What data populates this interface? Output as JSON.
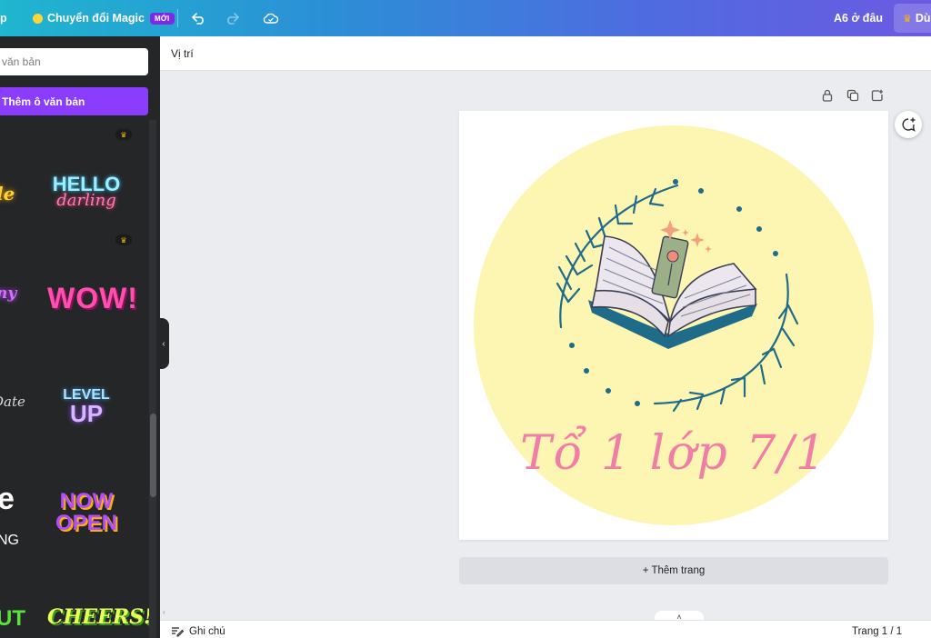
{
  "topbar": {
    "left_partial": "p",
    "magic_label": "Chuyển đổi Magic",
    "new_badge": "MỚI",
    "location_label": "A6 ở đâu",
    "try_label": "Dù"
  },
  "sidebar": {
    "search_placeholder": "văn bản",
    "add_text_button": "Thêm ô văn bản",
    "stickers": [
      {
        "top": "HELLO",
        "bottom": "darling"
      },
      {
        "text": "WOW!"
      },
      {
        "top": "LEVEL",
        "bottom": "UP"
      },
      {
        "top": "NOW",
        "bottom": "OPEN"
      },
      {
        "text": "CHEERS!"
      }
    ],
    "left_partials": [
      "le",
      "ny",
      "Date",
      "e",
      "NG",
      "UT"
    ]
  },
  "position_bar": {
    "label": "Vị trí"
  },
  "canvas": {
    "design_text": "Tổ 1 lớp 7/1",
    "add_page_button": "+ Thêm trang",
    "colors": {
      "circle": "#fdf6b2",
      "title": "#f07ea6",
      "leaves": "#1f6b8a"
    }
  },
  "bottombar": {
    "notes_label": "Ghi chú",
    "page_info": "Trang 1 / 1"
  }
}
